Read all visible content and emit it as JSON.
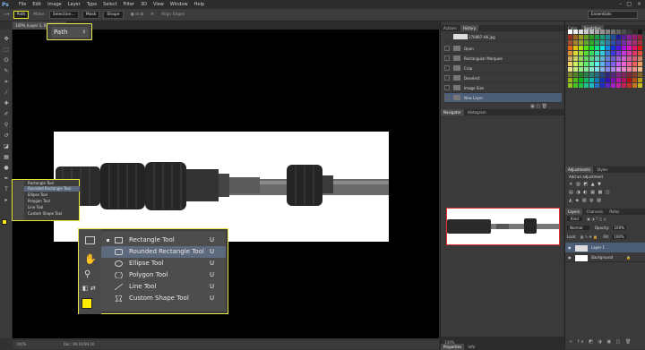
{
  "app": {
    "logo": "Ps"
  },
  "menu": [
    "File",
    "Edit",
    "Image",
    "Layer",
    "Type",
    "Select",
    "Filter",
    "3D",
    "View",
    "Window",
    "Help"
  ],
  "window_controls": [
    "–",
    "□",
    "×"
  ],
  "options": {
    "mode_value": "Path",
    "make_label": "Make:",
    "selection_btn": "Selection...",
    "mask_btn": "Mask",
    "shape_btn": "Shape",
    "align_edges": "Align Edges",
    "workspace": "Essentials"
  },
  "document": {
    "tab": "100% (Layer 1, R...",
    "status_zoom": "100%",
    "status_doc": "Doc: 99.1K/99.1K"
  },
  "path_callout": {
    "label": "Path"
  },
  "small_flyout": {
    "items": [
      "Rectangle Tool",
      "Rounded Rectangle Tool",
      "Ellipse Tool",
      "Polygon Tool",
      "Line Tool",
      "Custom Shape Tool"
    ]
  },
  "big_flyout": {
    "items": [
      {
        "label": "Rectangle Tool",
        "key": "U",
        "icon": "rectangle-icon"
      },
      {
        "label": "Rounded Rectangle Tool",
        "key": "U",
        "icon": "rounded-rectangle-icon"
      },
      {
        "label": "Ellipse Tool",
        "key": "U",
        "icon": "ellipse-icon"
      },
      {
        "label": "Polygon Tool",
        "key": "U",
        "icon": "polygon-icon"
      },
      {
        "label": "Line Tool",
        "key": "U",
        "icon": "line-icon"
      },
      {
        "label": "Custom Shape Tool",
        "key": "U",
        "icon": "custom-shape-icon"
      }
    ],
    "selected_index": 1
  },
  "history": {
    "tabs": [
      "Actions",
      "History"
    ],
    "snapshot": "P1170887-H6.jpg",
    "items": [
      "Open",
      "Rectangular Marquee",
      "Crop",
      "Deselect",
      "Image Size",
      "New Layer"
    ],
    "selected_index": 5
  },
  "navigator": {
    "tabs": [
      "Navigator",
      "Histogram"
    ]
  },
  "color": {
    "tabs": [
      "Color",
      "Swatches"
    ]
  },
  "adjustments": {
    "tabs": [
      "Adjustments",
      "Styles"
    ],
    "label": "Add an adjustment"
  },
  "layers": {
    "tabs": [
      "Layers",
      "Channels",
      "Paths"
    ],
    "kind": "Kind",
    "blend": "Normal",
    "opacity_label": "Opacity:",
    "opacity": "100%",
    "lock_label": "Lock:",
    "fill_label": "Fill:",
    "fill": "100%",
    "items": [
      "Layer 1",
      "Background"
    ]
  },
  "bottom_tabs": [
    "Properties",
    "Info"
  ],
  "colors": {
    "accent": "#e8e84a",
    "selection": "#5d6a7d",
    "fg": "#ffeb00"
  }
}
